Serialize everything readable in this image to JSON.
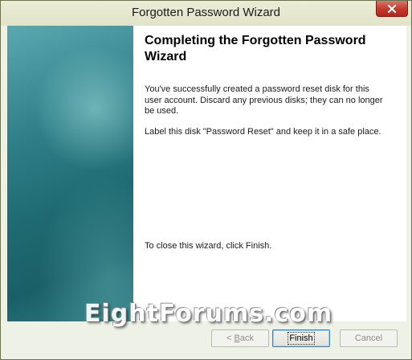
{
  "window": {
    "title": "Forgotten Password Wizard",
    "close_icon": "close-icon"
  },
  "main": {
    "heading": "Completing the Forgotten Password Wizard",
    "paragraph_1": "You've successfully created a password reset disk for this user account. Discard any previous disks; they can no longer be used.",
    "paragraph_2": "Label this disk \"Password Reset\" and keep it in a safe place.",
    "paragraph_3": "To close this wizard, click Finish."
  },
  "watermark": {
    "text": "EightForums.com"
  },
  "buttons": {
    "back_prefix": "< ",
    "back_mnemonic": "B",
    "back_rest": "ack",
    "finish_label": "Finish",
    "cancel_label": "Cancel"
  },
  "colors": {
    "titlebar": "#e1e4c8",
    "close_button": "#c2392b",
    "side_panel": "#1f6a72",
    "focus_border": "#3c7fb1"
  }
}
